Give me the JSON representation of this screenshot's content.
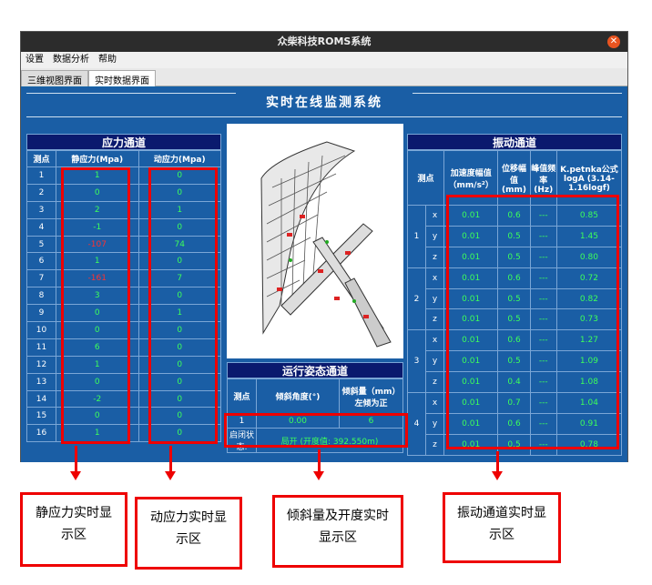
{
  "window": {
    "title": "众柴科技ROMS系统"
  },
  "menu": [
    "设置",
    "数据分析",
    "帮助"
  ],
  "tabs": [
    "三维视图界面",
    "实时数据界面"
  ],
  "header": "实时在线监测系统",
  "stress": {
    "title": "应力通道",
    "cols": [
      "测点",
      "静应力(Mpa)",
      "动应力(Mpa)"
    ],
    "rows": [
      [
        "1",
        "1",
        "0"
      ],
      [
        "2",
        "0",
        "0"
      ],
      [
        "3",
        "2",
        "1"
      ],
      [
        "4",
        "-1",
        "0"
      ],
      [
        "5",
        "-107",
        "74"
      ],
      [
        "6",
        "1",
        "0"
      ],
      [
        "7",
        "-161",
        "7"
      ],
      [
        "8",
        "3",
        "0"
      ],
      [
        "9",
        "0",
        "1"
      ],
      [
        "10",
        "0",
        "0"
      ],
      [
        "11",
        "6",
        "0"
      ],
      [
        "12",
        "1",
        "0"
      ],
      [
        "13",
        "0",
        "0"
      ],
      [
        "14",
        "-2",
        "0"
      ],
      [
        "15",
        "0",
        "0"
      ],
      [
        "16",
        "1",
        "0"
      ]
    ]
  },
  "posture": {
    "title": "运行姿态通道",
    "cols": [
      "测点",
      "倾斜角度(°)",
      "倾斜量（mm）左倾为正"
    ],
    "row": [
      "1",
      "0.00",
      "6"
    ],
    "status_label": "启闭状态:",
    "status_value": "局开 (开度值: 392.550m)"
  },
  "vibration": {
    "title": "振动通道",
    "cols": [
      "测点",
      "",
      "加速度幅值（mm/s²）",
      "位移幅值(mm)",
      "峰值频率(Hz)",
      "K.petnka公式logA (3.14-1.16logf)"
    ],
    "groups": [
      {
        "id": "1",
        "rows": [
          [
            "x",
            "0.01",
            "0.6",
            "---",
            "0.85"
          ],
          [
            "y",
            "0.01",
            "0.5",
            "---",
            "1.45"
          ],
          [
            "z",
            "0.01",
            "0.5",
            "---",
            "0.80"
          ]
        ]
      },
      {
        "id": "2",
        "rows": [
          [
            "x",
            "0.01",
            "0.6",
            "---",
            "0.72"
          ],
          [
            "y",
            "0.01",
            "0.5",
            "---",
            "0.82"
          ],
          [
            "z",
            "0.01",
            "0.5",
            "---",
            "0.73"
          ]
        ]
      },
      {
        "id": "3",
        "rows": [
          [
            "x",
            "0.01",
            "0.6",
            "---",
            "1.27"
          ],
          [
            "y",
            "0.01",
            "0.5",
            "---",
            "1.09"
          ],
          [
            "z",
            "0.01",
            "0.4",
            "---",
            "1.08"
          ]
        ]
      },
      {
        "id": "4",
        "rows": [
          [
            "x",
            "0.01",
            "0.7",
            "---",
            "1.04"
          ],
          [
            "y",
            "0.01",
            "0.6",
            "---",
            "0.91"
          ],
          [
            "z",
            "0.01",
            "0.5",
            "---",
            "0.78"
          ]
        ]
      }
    ]
  },
  "labels": {
    "static": "静应力实时显示区",
    "dynamic": "动应力实时显示区",
    "tilt": "倾斜量及开度实时显示区",
    "vib": "振动通道实时显示区"
  }
}
